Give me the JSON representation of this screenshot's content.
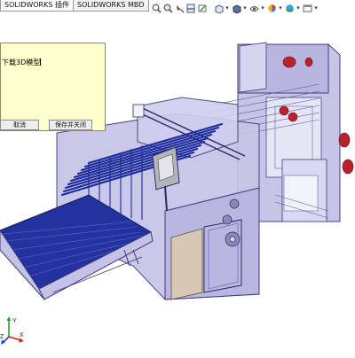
{
  "tabs": [
    {
      "label": "SOLIDWORKS 插件",
      "active": true
    },
    {
      "label": "SOLIDWORKS MBD",
      "active": false
    }
  ],
  "toolbar": {
    "icons": [
      "zoom-to-fit-icon",
      "zoom-area-icon",
      "previous-view-icon",
      "section-view-icon",
      "dynamic-annotation-icon",
      "view-orientation-icon",
      "display-style-icon",
      "hide-show-icon",
      "edit-appearance-icon",
      "apply-scene-icon",
      "view-settings-icon"
    ]
  },
  "dialog": {
    "text_value": "下载3D模型",
    "cancel_label": "取消",
    "save_close_label": "保存并关闭"
  },
  "colors": {
    "dialog_bg": "#ffffcd",
    "frame_fill": "#c2c0e6",
    "frame_edge": "#3e3a78",
    "roller_blue": "#1c2b9a",
    "red_part": "#b8222c"
  },
  "triad": {
    "x_label": "X",
    "y_label": "Y",
    "z_label": "Z"
  }
}
